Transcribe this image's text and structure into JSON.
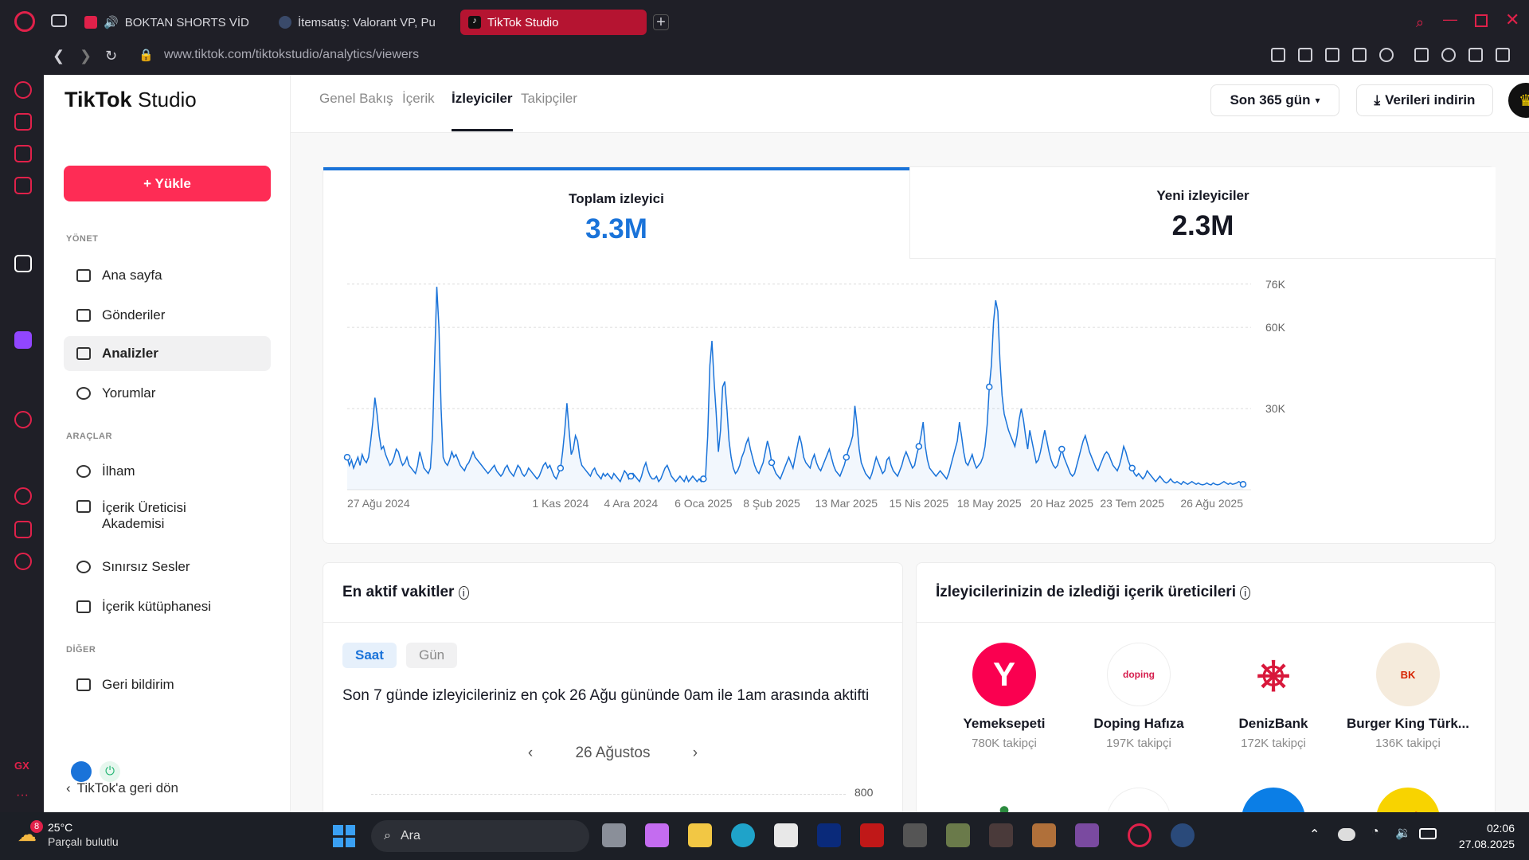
{
  "browser": {
    "tabs": [
      {
        "label": "BOKTAN SHORTS VİD"
      },
      {
        "label": "İtemsatış: Valorant VP, Pu"
      },
      {
        "label": "TikTok Studio"
      }
    ],
    "url": "www.tiktok.com/tiktokstudio/analytics/viewers"
  },
  "brand": {
    "logo": "TikTok",
    "logo_suffix": "Studio",
    "accent": "#fe2c55",
    "chart_color": "#1a73d9"
  },
  "sidebar": {
    "upload_label": "+ Yükle",
    "sections": [
      "YÖNET",
      "ARAÇLAR",
      "DİĞER"
    ],
    "items": [
      {
        "label": "Ana sayfa",
        "icon": "home-icon"
      },
      {
        "label": "Gönderiler",
        "icon": "folder-icon"
      },
      {
        "label": "Analizler",
        "icon": "analytics-icon"
      },
      {
        "label": "Yorumlar",
        "icon": "comment-icon"
      },
      {
        "label": "İlham",
        "icon": "lightbulb-icon"
      },
      {
        "label": "İçerik Üreticisi Akademisi",
        "icon": "academy-icon"
      },
      {
        "label": "Sınırsız Sesler",
        "icon": "music-icon"
      },
      {
        "label": "İçerik kütüphanesi",
        "icon": "library-icon"
      },
      {
        "label": "Geri bildirim",
        "icon": "mail-icon"
      }
    ],
    "back_label": "TikTok'a geri dön"
  },
  "header": {
    "tabs": [
      {
        "label": "Genel Bakış"
      },
      {
        "label": "İçerik"
      },
      {
        "label": "İzleyiciler"
      },
      {
        "label": "Takipçiler"
      }
    ],
    "range_label": "Son 365 gün",
    "download_label": "Verileri indirin"
  },
  "kpis": [
    {
      "label": "Toplam izleyici",
      "value": "3.3M"
    },
    {
      "label": "Yeni izleyiciler",
      "value": "2.3M"
    }
  ],
  "chart_data": {
    "type": "line",
    "x_ticks": [
      "27 Ağu 2024",
      "1 Kas 2024",
      "4 Ara 2024",
      "6 Oca 2025",
      "8 Şub 2025",
      "13 Mar 2025",
      "15 Nis 2025",
      "18 May 2025",
      "20 Haz 2025",
      "23 Tem 2025",
      "26 Ağu 2025"
    ],
    "y_ticks": [
      "76K",
      "60K",
      "30K"
    ],
    "ylim": [
      0,
      78000
    ],
    "grid": true,
    "series": [
      {
        "values": [
          12000,
          9000,
          11000,
          8000,
          10000,
          12000,
          9000,
          13000,
          11000,
          10000,
          12000,
          18000,
          25000,
          34000,
          28000,
          20000,
          15000,
          16000,
          13000,
          11000,
          9000,
          10000,
          12000,
          15000,
          14000,
          11000,
          9000,
          10000,
          12000,
          9000,
          8000,
          7000,
          6000,
          9000,
          14000,
          11000,
          8000,
          7000,
          6000,
          8000,
          20000,
          48000,
          75000,
          60000,
          30000,
          12000,
          10000,
          9000,
          11000,
          14000,
          12000,
          13000,
          11000,
          9000,
          8000,
          7000,
          9000,
          10000,
          12000,
          14000,
          12000,
          11000,
          10000,
          9000,
          8000,
          7000,
          6000,
          7000,
          8000,
          9000,
          7000,
          6000,
          5000,
          6000,
          8000,
          9000,
          7000,
          6000,
          5000,
          7000,
          9000,
          8000,
          6000,
          5000,
          6000,
          8000,
          7000,
          6000,
          5000,
          4000,
          5000,
          7000,
          9000,
          10000,
          8000,
          9000,
          7000,
          5000,
          4000,
          6000,
          8000,
          14000,
          22000,
          32000,
          22000,
          13000,
          15000,
          20000,
          18000,
          12000,
          9000,
          8000,
          7000,
          6000,
          5000,
          7000,
          8000,
          6000,
          5000,
          4000,
          6000,
          5000,
          6000,
          5000,
          4000,
          6000,
          5000,
          4000,
          3000,
          5000,
          7000,
          6000,
          4000,
          5000,
          6000,
          5000,
          4000,
          3000,
          5000,
          8000,
          10000,
          7000,
          5000,
          4000,
          4000,
          5000,
          3000,
          4000,
          6000,
          8000,
          9000,
          7000,
          5000,
          4000,
          3000,
          4000,
          5000,
          4000,
          3000,
          5000,
          3000,
          4000,
          5000,
          4000,
          3000,
          4000,
          3000,
          4000,
          5000,
          20000,
          46000,
          55000,
          40000,
          28000,
          14000,
          22000,
          38000,
          40000,
          30000,
          18000,
          12000,
          8000,
          6000,
          7000,
          9000,
          12000,
          14000,
          17000,
          19000,
          15000,
          12000,
          9000,
          7000,
          6000,
          8000,
          10000,
          14000,
          18000,
          15000,
          10000,
          8000,
          6000,
          5000,
          4000,
          6000,
          8000,
          10000,
          12000,
          10000,
          8000,
          12000,
          16000,
          20000,
          17000,
          12000,
          10000,
          9000,
          8000,
          11000,
          13000,
          10000,
          8000,
          7000,
          9000,
          11000,
          13000,
          15000,
          12000,
          9000,
          7000,
          6000,
          5000,
          7000,
          9000,
          12000,
          15000,
          17000,
          20000,
          31000,
          24000,
          15000,
          10000,
          8000,
          6000,
          5000,
          4000,
          6000,
          9000,
          12000,
          10000,
          8000,
          6000,
          7000,
          11000,
          12000,
          9000,
          7000,
          6000,
          5000,
          7000,
          9000,
          12000,
          14000,
          12000,
          10000,
          8000,
          9000,
          13000,
          16000,
          20000,
          25000,
          16000,
          11000,
          8000,
          7000,
          6000,
          5000,
          6000,
          7000,
          6000,
          5000,
          4000,
          6000,
          9000,
          12000,
          15000,
          18000,
          25000,
          20000,
          14000,
          10000,
          9000,
          11000,
          13000,
          10000,
          8000,
          9000,
          10000,
          12000,
          16000,
          24000,
          38000,
          46000,
          62000,
          70000,
          66000,
          48000,
          35000,
          28000,
          25000,
          22000,
          20000,
          18000,
          16000,
          20000,
          26000,
          30000,
          26000,
          20000,
          15000,
          22000,
          18000,
          14000,
          10000,
          11000,
          14000,
          18000,
          22000,
          18000,
          14000,
          11000,
          9000,
          8000,
          9000,
          12000,
          15000,
          12000,
          10000,
          8000,
          6000,
          5000,
          6000,
          9000,
          12000,
          15000,
          18000,
          20000,
          17000,
          14000,
          12000,
          10000,
          8000,
          7000,
          9000,
          11000,
          13000,
          14000,
          13000,
          11000,
          9000,
          8000,
          7000,
          9000,
          12000,
          16000,
          14000,
          11000,
          9000,
          8000,
          6000,
          5000,
          6000,
          5000,
          4000,
          5000,
          7000,
          6000,
          5000,
          4000,
          3000,
          4000,
          5000,
          4000,
          3000,
          2500,
          3000,
          4000,
          3000,
          2500,
          3000,
          2500,
          2000,
          3000,
          2500,
          2000,
          2500,
          3000,
          2500,
          2000,
          2500,
          2000,
          1800,
          2000,
          2500,
          2000,
          1800,
          2500,
          2000,
          1800,
          2000,
          2500,
          3000,
          2500,
          2000,
          2500,
          2000,
          2200,
          2500,
          3000,
          2500,
          2000
        ]
      }
    ]
  },
  "active_times": {
    "title": "En aktif vakitler",
    "toggle": [
      "Saat",
      "Gün"
    ],
    "sentence": "Son 7 günde izleyicileriniz en çok 26 Ağu gününde 0am ile 1am arasında aktifti",
    "date_label": "26 Ağustos",
    "y_tick": "800"
  },
  "creators": {
    "title": "İzleyicilerinizin de izlediği içerik üreticileri",
    "items": [
      {
        "name": "Yemeksepeti",
        "followers": "780K takipçi",
        "color": "#fa0050"
      },
      {
        "name": "Doping Hafıza",
        "followers": "197K takipçi",
        "color": "#ffffff"
      },
      {
        "name": "DenizBank",
        "followers": "172K takipçi",
        "color": "#ffffff"
      },
      {
        "name": "Burger King Türk...",
        "followers": "136K takipçi",
        "color": "#f5ebdc"
      }
    ]
  },
  "taskbar": {
    "weather_temp": "25°C",
    "weather_desc": "Parçalı bulutlu",
    "weather_badge": "8",
    "search": "Ara",
    "time": "02:06",
    "date": "27.08.2025"
  }
}
